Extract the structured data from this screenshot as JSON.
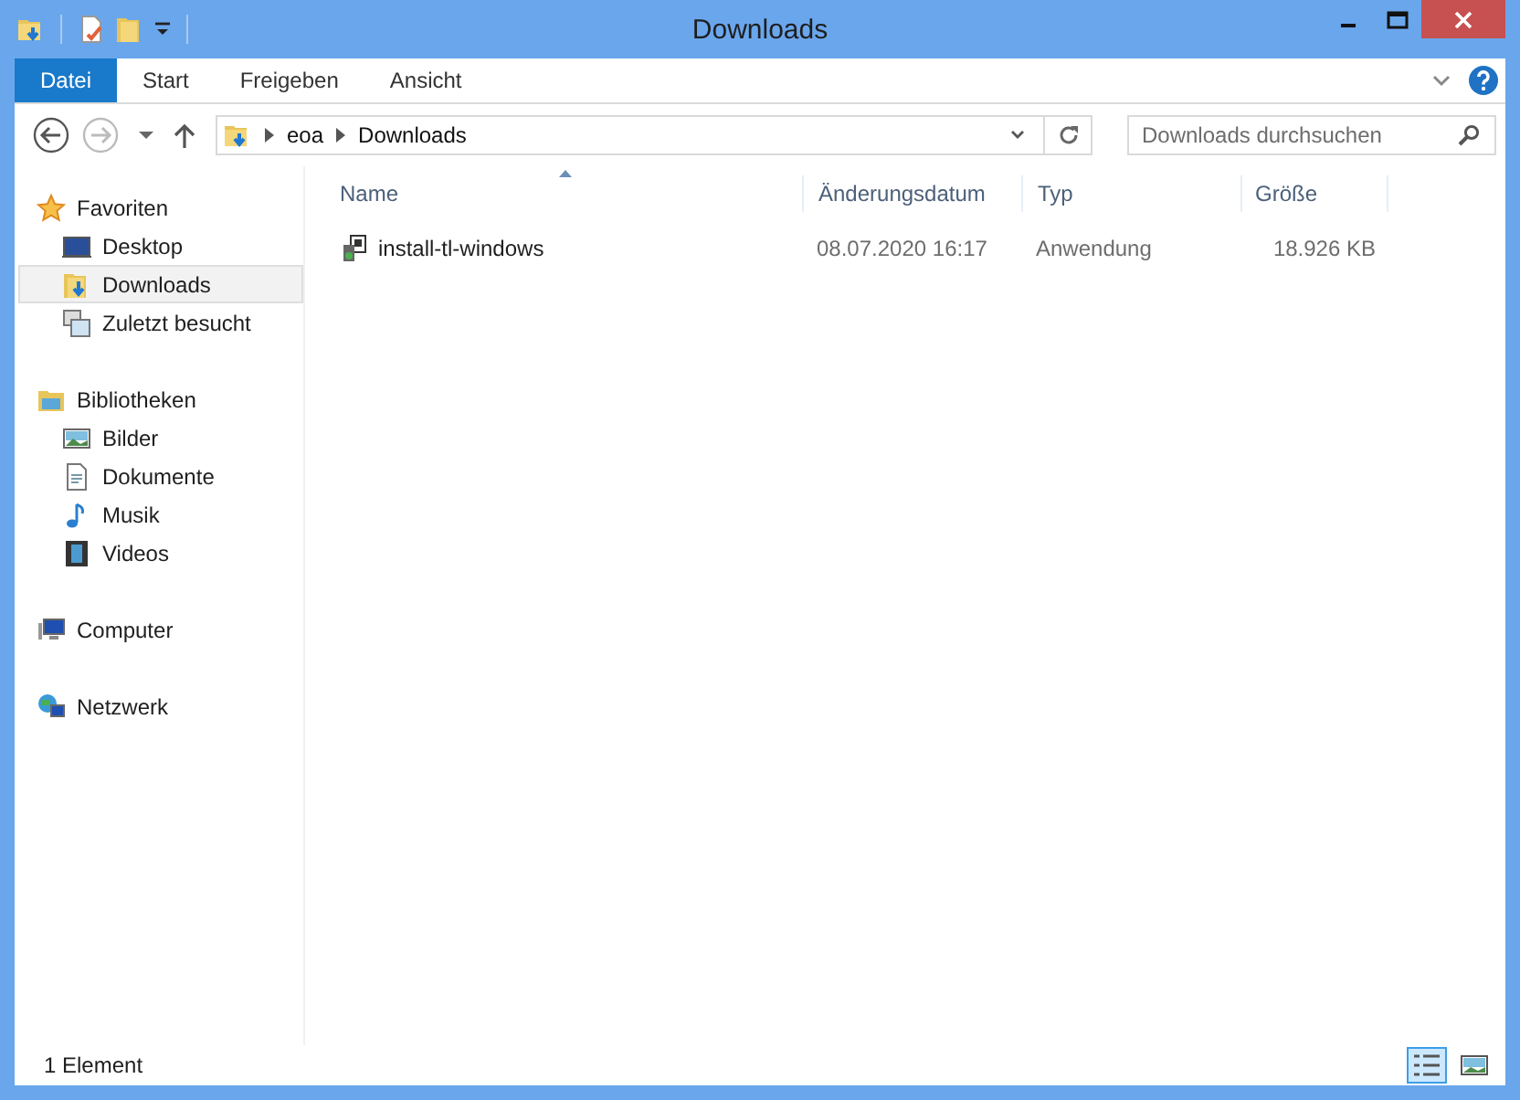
{
  "window": {
    "title": "Downloads"
  },
  "ribbon": {
    "tabs": [
      {
        "label": "Datei",
        "selected": true
      },
      {
        "label": "Start",
        "selected": false
      },
      {
        "label": "Freigeben",
        "selected": false
      },
      {
        "label": "Ansicht",
        "selected": false
      }
    ]
  },
  "navigation": {
    "path": [
      "eoa",
      "Downloads"
    ],
    "search": {
      "placeholder": "Downloads durchsuchen"
    }
  },
  "sidebar": {
    "groups": [
      {
        "label": "Favoriten",
        "kind": "star",
        "children": [
          {
            "label": "Desktop",
            "kind": "desktop",
            "selected": false
          },
          {
            "label": "Downloads",
            "kind": "downloads",
            "selected": true
          },
          {
            "label": "Zuletzt besucht",
            "kind": "recent",
            "selected": false
          }
        ]
      },
      {
        "label": "Bibliotheken",
        "kind": "library",
        "children": [
          {
            "label": "Bilder",
            "kind": "pictures",
            "selected": false
          },
          {
            "label": "Dokumente",
            "kind": "documents",
            "selected": false
          },
          {
            "label": "Musik",
            "kind": "music",
            "selected": false
          },
          {
            "label": "Videos",
            "kind": "videos",
            "selected": false
          }
        ]
      },
      {
        "label": "Computer",
        "kind": "computer"
      },
      {
        "label": "Netzwerk",
        "kind": "network"
      }
    ]
  },
  "file_list": {
    "columns": [
      {
        "label": "Name",
        "sorted": true
      },
      {
        "label": "Änderungsdatum",
        "sorted": false
      },
      {
        "label": "Typ",
        "sorted": false
      },
      {
        "label": "Größe",
        "sorted": false
      }
    ],
    "rows": [
      {
        "name": "install-tl-windows",
        "date": "08.07.2020 16:17",
        "type": "Anwendung",
        "size": "18.926 KB",
        "kind": "installer"
      }
    ]
  },
  "status_bar": {
    "text": "1 Element",
    "views": [
      {
        "kind": "details",
        "selected": true
      },
      {
        "kind": "tiles",
        "selected": false
      }
    ]
  }
}
